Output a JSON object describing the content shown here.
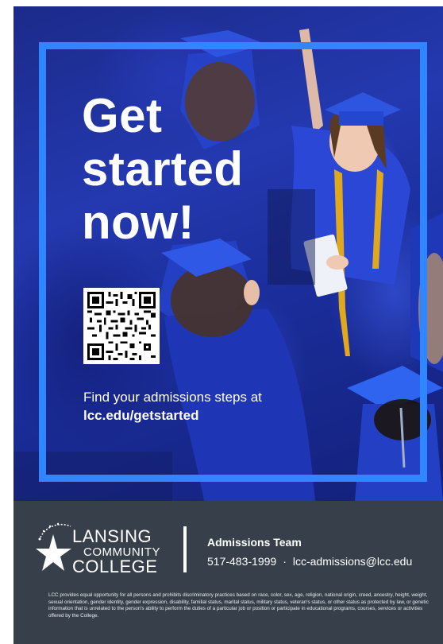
{
  "headline": [
    "Get",
    "started",
    "now!"
  ],
  "cta": {
    "line1": "Find your admissions steps at",
    "url": "lcc.edu/getstarted"
  },
  "qr_code": {
    "icon": "qr-code-icon"
  },
  "footer": {
    "logo": {
      "line1": "LANSING",
      "line2": "COMMUNITY",
      "line3": "COLLEGE"
    },
    "contact": {
      "team": "Admissions Team",
      "phone": "517-483-1999",
      "separator": "·",
      "email": "lcc-admissions@lcc.edu"
    },
    "disclaimer": "LCC provides equal opportunity for all persons and prohibits discriminatory practices based on race, color, sex, age, religion, national origin, creed, ancestry, height, weight, sexual orientation, gender identity, gender expression, disability, familial status, marital status, military status, veteran's status, or other status as protected by law, or genetic information that is unrelated to the person's ability to perform the duties of a particular job or position or participate in educational programs, courses, services or activities offered by the College."
  },
  "colors": {
    "frame": "#2f86ff",
    "photo_blue": "#2439b0",
    "footer_bg": "#37404a",
    "tassel_gold": "#e0a81c"
  }
}
